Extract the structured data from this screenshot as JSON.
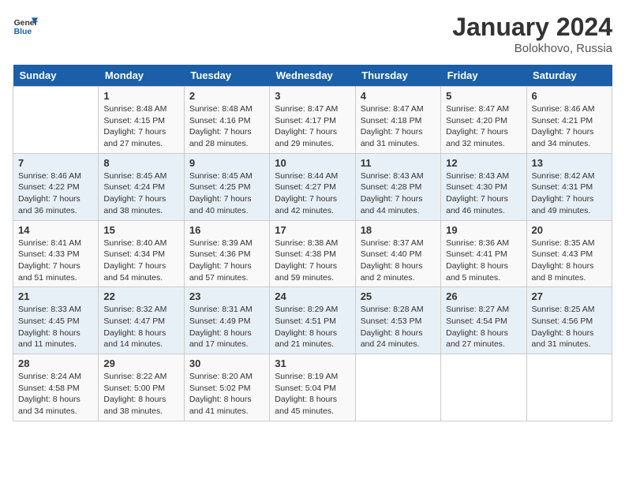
{
  "header": {
    "logo_line1": "General",
    "logo_line2": "Blue",
    "month_title": "January 2024",
    "subtitle": "Bolokhovo, Russia"
  },
  "days_of_week": [
    "Sunday",
    "Monday",
    "Tuesday",
    "Wednesday",
    "Thursday",
    "Friday",
    "Saturday"
  ],
  "weeks": [
    [
      {
        "day": "",
        "info": ""
      },
      {
        "day": "1",
        "info": "Sunrise: 8:48 AM\nSunset: 4:15 PM\nDaylight: 7 hours\nand 27 minutes."
      },
      {
        "day": "2",
        "info": "Sunrise: 8:48 AM\nSunset: 4:16 PM\nDaylight: 7 hours\nand 28 minutes."
      },
      {
        "day": "3",
        "info": "Sunrise: 8:47 AM\nSunset: 4:17 PM\nDaylight: 7 hours\nand 29 minutes."
      },
      {
        "day": "4",
        "info": "Sunrise: 8:47 AM\nSunset: 4:18 PM\nDaylight: 7 hours\nand 31 minutes."
      },
      {
        "day": "5",
        "info": "Sunrise: 8:47 AM\nSunset: 4:20 PM\nDaylight: 7 hours\nand 32 minutes."
      },
      {
        "day": "6",
        "info": "Sunrise: 8:46 AM\nSunset: 4:21 PM\nDaylight: 7 hours\nand 34 minutes."
      }
    ],
    [
      {
        "day": "7",
        "info": "Sunrise: 8:46 AM\nSunset: 4:22 PM\nDaylight: 7 hours\nand 36 minutes."
      },
      {
        "day": "8",
        "info": "Sunrise: 8:45 AM\nSunset: 4:24 PM\nDaylight: 7 hours\nand 38 minutes."
      },
      {
        "day": "9",
        "info": "Sunrise: 8:45 AM\nSunset: 4:25 PM\nDaylight: 7 hours\nand 40 minutes."
      },
      {
        "day": "10",
        "info": "Sunrise: 8:44 AM\nSunset: 4:27 PM\nDaylight: 7 hours\nand 42 minutes."
      },
      {
        "day": "11",
        "info": "Sunrise: 8:43 AM\nSunset: 4:28 PM\nDaylight: 7 hours\nand 44 minutes."
      },
      {
        "day": "12",
        "info": "Sunrise: 8:43 AM\nSunset: 4:30 PM\nDaylight: 7 hours\nand 46 minutes."
      },
      {
        "day": "13",
        "info": "Sunrise: 8:42 AM\nSunset: 4:31 PM\nDaylight: 7 hours\nand 49 minutes."
      }
    ],
    [
      {
        "day": "14",
        "info": "Sunrise: 8:41 AM\nSunset: 4:33 PM\nDaylight: 7 hours\nand 51 minutes."
      },
      {
        "day": "15",
        "info": "Sunrise: 8:40 AM\nSunset: 4:34 PM\nDaylight: 7 hours\nand 54 minutes."
      },
      {
        "day": "16",
        "info": "Sunrise: 8:39 AM\nSunset: 4:36 PM\nDaylight: 7 hours\nand 57 minutes."
      },
      {
        "day": "17",
        "info": "Sunrise: 8:38 AM\nSunset: 4:38 PM\nDaylight: 7 hours\nand 59 minutes."
      },
      {
        "day": "18",
        "info": "Sunrise: 8:37 AM\nSunset: 4:40 PM\nDaylight: 8 hours\nand 2 minutes."
      },
      {
        "day": "19",
        "info": "Sunrise: 8:36 AM\nSunset: 4:41 PM\nDaylight: 8 hours\nand 5 minutes."
      },
      {
        "day": "20",
        "info": "Sunrise: 8:35 AM\nSunset: 4:43 PM\nDaylight: 8 hours\nand 8 minutes."
      }
    ],
    [
      {
        "day": "21",
        "info": "Sunrise: 8:33 AM\nSunset: 4:45 PM\nDaylight: 8 hours\nand 11 minutes."
      },
      {
        "day": "22",
        "info": "Sunrise: 8:32 AM\nSunset: 4:47 PM\nDaylight: 8 hours\nand 14 minutes."
      },
      {
        "day": "23",
        "info": "Sunrise: 8:31 AM\nSunset: 4:49 PM\nDaylight: 8 hours\nand 17 minutes."
      },
      {
        "day": "24",
        "info": "Sunrise: 8:29 AM\nSunset: 4:51 PM\nDaylight: 8 hours\nand 21 minutes."
      },
      {
        "day": "25",
        "info": "Sunrise: 8:28 AM\nSunset: 4:53 PM\nDaylight: 8 hours\nand 24 minutes."
      },
      {
        "day": "26",
        "info": "Sunrise: 8:27 AM\nSunset: 4:54 PM\nDaylight: 8 hours\nand 27 minutes."
      },
      {
        "day": "27",
        "info": "Sunrise: 8:25 AM\nSunset: 4:56 PM\nDaylight: 8 hours\nand 31 minutes."
      }
    ],
    [
      {
        "day": "28",
        "info": "Sunrise: 8:24 AM\nSunset: 4:58 PM\nDaylight: 8 hours\nand 34 minutes."
      },
      {
        "day": "29",
        "info": "Sunrise: 8:22 AM\nSunset: 5:00 PM\nDaylight: 8 hours\nand 38 minutes."
      },
      {
        "day": "30",
        "info": "Sunrise: 8:20 AM\nSunset: 5:02 PM\nDaylight: 8 hours\nand 41 minutes."
      },
      {
        "day": "31",
        "info": "Sunrise: 8:19 AM\nSunset: 5:04 PM\nDaylight: 8 hours\nand 45 minutes."
      },
      {
        "day": "",
        "info": ""
      },
      {
        "day": "",
        "info": ""
      },
      {
        "day": "",
        "info": ""
      }
    ]
  ]
}
